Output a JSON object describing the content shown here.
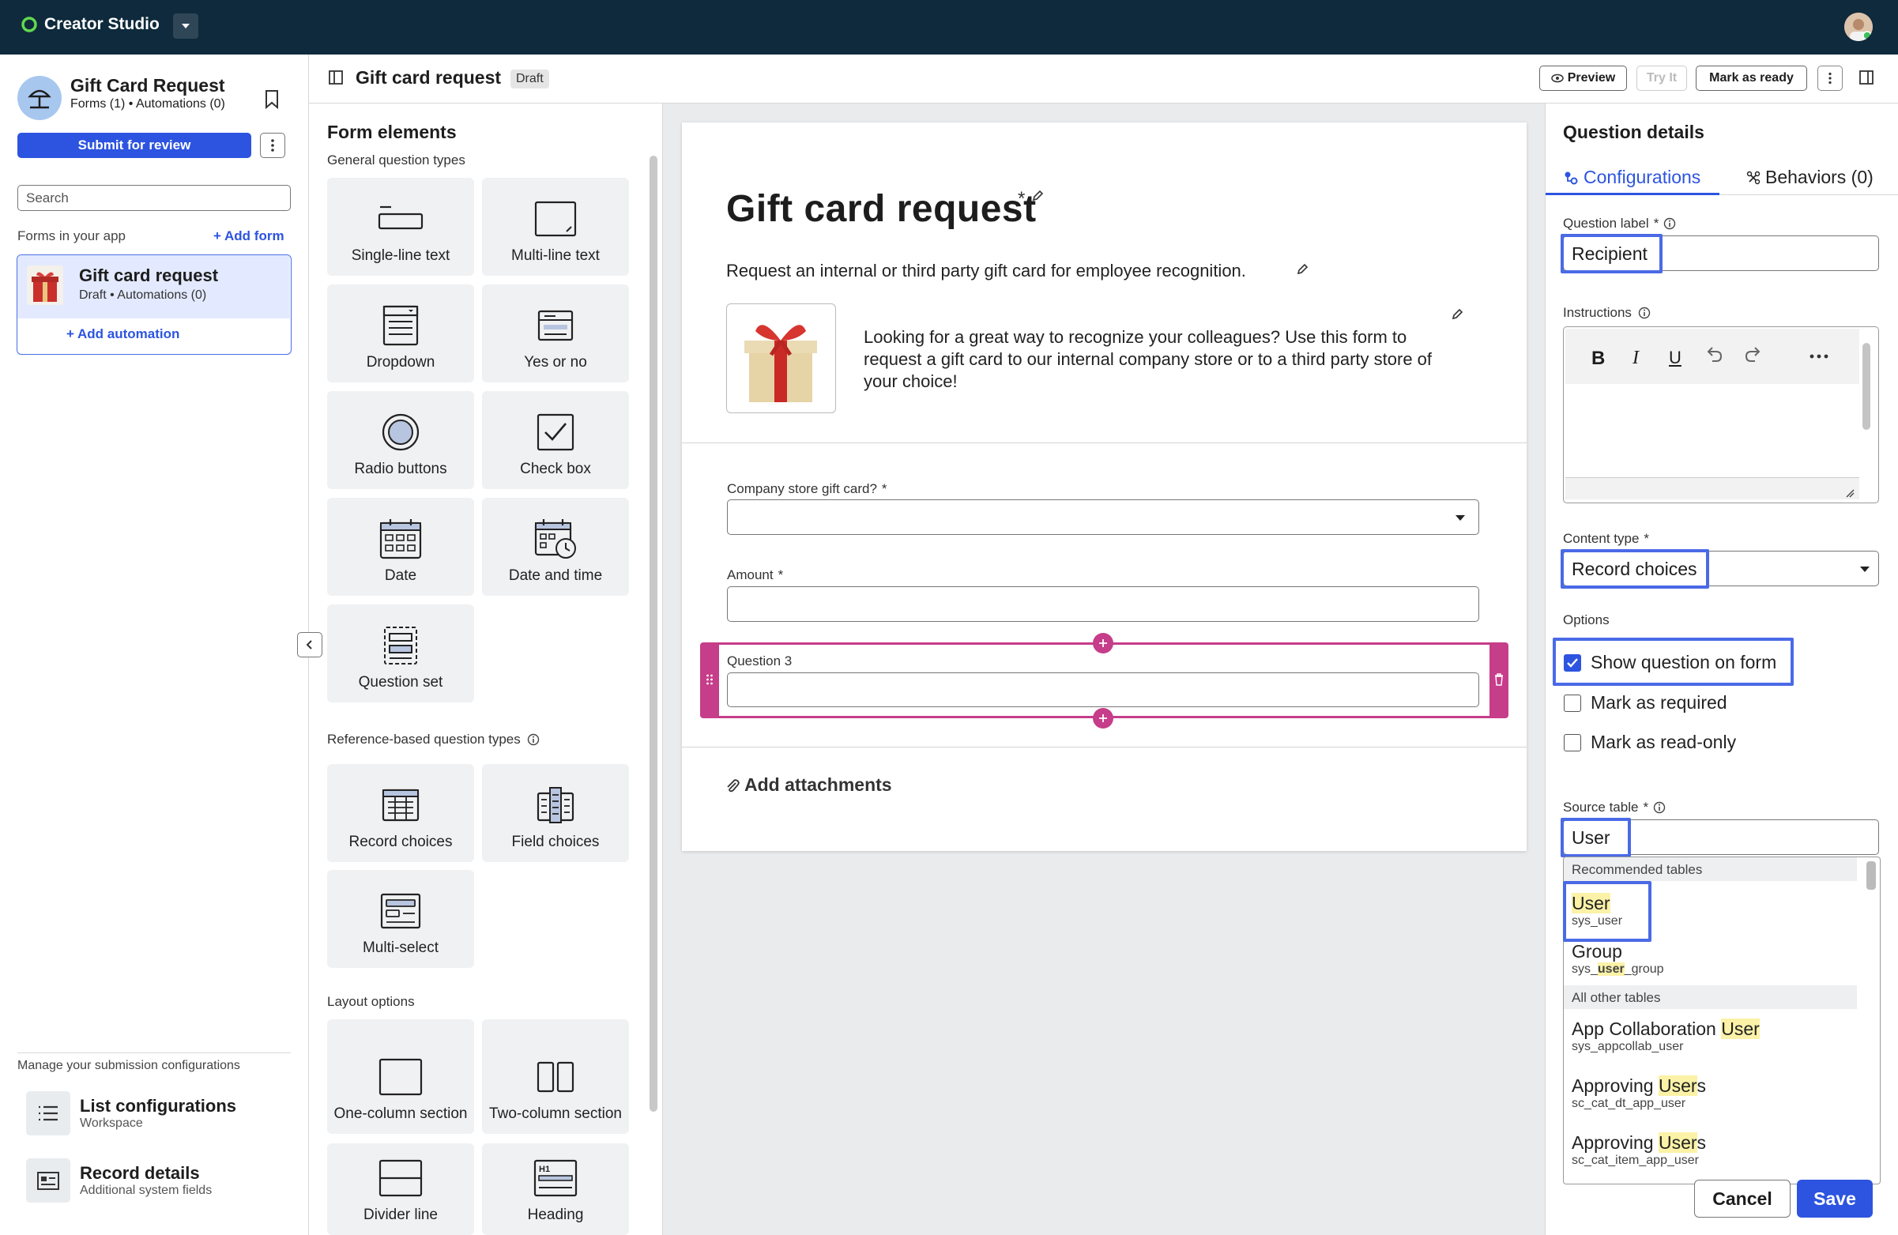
{
  "topbar": {
    "brand": "Creator Studio"
  },
  "sidebar": {
    "app_title": "Gift Card Request",
    "app_subtitle": "Forms (1) • Automations (0)",
    "submit_label": "Submit for review",
    "search_placeholder": "Search",
    "forms_label": "Forms in your app",
    "add_form_label": "+ Add form",
    "form_card": {
      "title": "Gift card request",
      "subtitle": "Draft • Automations (0)",
      "add_automation": "+ Add automation"
    },
    "manage_label": "Manage your submission configurations",
    "nav": [
      {
        "title": "List configurations",
        "subtitle": "Workspace",
        "icon": "list-icon"
      },
      {
        "title": "Record details",
        "subtitle": "Additional system fields",
        "icon": "record-details-icon"
      }
    ]
  },
  "header": {
    "title": "Gift card request",
    "badge": "Draft",
    "preview_label": "Preview",
    "tryit_label": "Try It",
    "mark_ready_label": "Mark as ready"
  },
  "palette": {
    "title": "Form elements",
    "general_label": "General question types",
    "general": [
      {
        "label": "Single-line text",
        "icon": "single-line-text-icon"
      },
      {
        "label": "Multi-line text",
        "icon": "multi-line-text-icon"
      },
      {
        "label": "Dropdown",
        "icon": "dropdown-icon"
      },
      {
        "label": "Yes or no",
        "icon": "yes-no-icon"
      },
      {
        "label": "Radio buttons",
        "icon": "radio-icon"
      },
      {
        "label": "Check box",
        "icon": "checkbox-icon"
      },
      {
        "label": "Date",
        "icon": "calendar-icon"
      },
      {
        "label": "Date and time",
        "icon": "calendar-clock-icon"
      },
      {
        "label": "Question set",
        "icon": "question-set-icon"
      }
    ],
    "reference_label": "Reference-based question types",
    "reference": [
      {
        "label": "Record choices",
        "icon": "record-choices-icon"
      },
      {
        "label": "Field choices",
        "icon": "field-choices-icon"
      },
      {
        "label": "Multi-select",
        "icon": "multi-select-icon"
      }
    ],
    "layout_label": "Layout options",
    "layout": [
      {
        "label": "One-column section",
        "icon": "one-column-icon"
      },
      {
        "label": "Two-column section",
        "icon": "two-column-icon"
      },
      {
        "label": "Divider line",
        "icon": "divider-icon"
      },
      {
        "label": "Heading",
        "icon": "heading-icon"
      }
    ]
  },
  "form": {
    "title": "Gift card request",
    "title_marks": "*",
    "description": "Request an internal or third party gift card for employee recognition.",
    "intro": "Looking for a great way to recognize your colleagues? Use this form to request a gift card to our internal company store or to a third party store of your choice!",
    "questions": [
      {
        "label": "Company store gift card?",
        "required": "*"
      },
      {
        "label": "Amount",
        "required": "*"
      },
      {
        "label": "Question 3"
      }
    ],
    "attachments_label": "Add attachments"
  },
  "details": {
    "title": "Question details",
    "tabs": [
      {
        "label": "Configurations",
        "active": true
      },
      {
        "label": "Behaviors (0)",
        "active": false
      }
    ],
    "question_label_label": "Question label",
    "question_label_value": "Recipient",
    "instructions_label": "Instructions",
    "content_type_label": "Content type",
    "content_type_value": "Record choices",
    "options_label": "Options",
    "options": [
      {
        "label": "Show question on form",
        "checked": true
      },
      {
        "label": "Mark as required",
        "checked": false
      },
      {
        "label": "Mark as read-only",
        "checked": false
      }
    ],
    "source_table_label": "Source table",
    "source_table_value": "User",
    "required_mark": "*",
    "dropdown": {
      "recommended_label": "Recommended tables",
      "other_label": "All other tables",
      "recommended": [
        {
          "name": "User",
          "sys": "sys_user"
        },
        {
          "name": "Group",
          "sys": "sys_user_group"
        }
      ],
      "others": [
        {
          "name": "App Collaboration User",
          "sys": "sys_appcollab_user"
        },
        {
          "name": "Approving Users",
          "sys": "sc_cat_dt_app_user"
        },
        {
          "name": "Approving Users",
          "sys": "sc_cat_item_app_user"
        }
      ]
    },
    "cancel_label": "Cancel",
    "save_label": "Save"
  },
  "colors": {
    "accent": "#2d54e0",
    "topbar": "#0e2a3c",
    "selected_question": "#c63d8a",
    "highlight": "#4a6ae6",
    "match_highlight": "#fbf2a7"
  }
}
